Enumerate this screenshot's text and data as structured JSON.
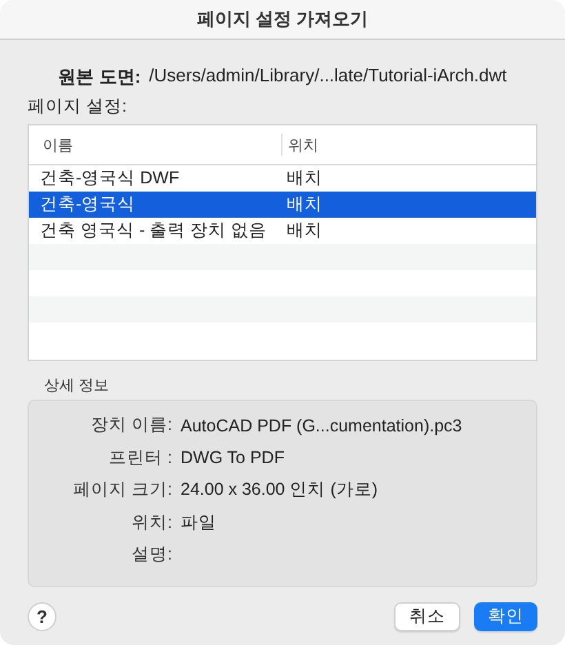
{
  "window": {
    "title": "페이지 설정 가져오기"
  },
  "source": {
    "label": "원본 도면:",
    "value": "/Users/admin/Library/...late/Tutorial-iArch.dwt"
  },
  "list_label": "페이지 설정:",
  "table": {
    "columns": [
      "이름",
      "위치"
    ],
    "rows": [
      {
        "cells": [
          "건축-영국식 DWF",
          "배치"
        ],
        "selected": false
      },
      {
        "cells": [
          "건축-영국식",
          "배치"
        ],
        "selected": true
      },
      {
        "cells": [
          "건축 영국식 - 출력 장치 없음",
          "배치"
        ],
        "selected": false
      }
    ]
  },
  "details": {
    "title": "상세 정보",
    "fields": [
      {
        "label": "장치 이름:",
        "value": "AutoCAD PDF (G...cumentation).pc3"
      },
      {
        "label": "프린터 :",
        "value": "DWG To PDF"
      },
      {
        "label": "페이지 크기:",
        "value": "24.00 x 36.00 인치 (가로)"
      },
      {
        "label": "위치:",
        "value": "파일"
      },
      {
        "label": "설명:"
      }
    ]
  },
  "help_button": "?",
  "buttons": [
    {
      "label": "취소",
      "kind": "secondary"
    },
    {
      "label": "확인",
      "kind": "primary"
    }
  ]
}
